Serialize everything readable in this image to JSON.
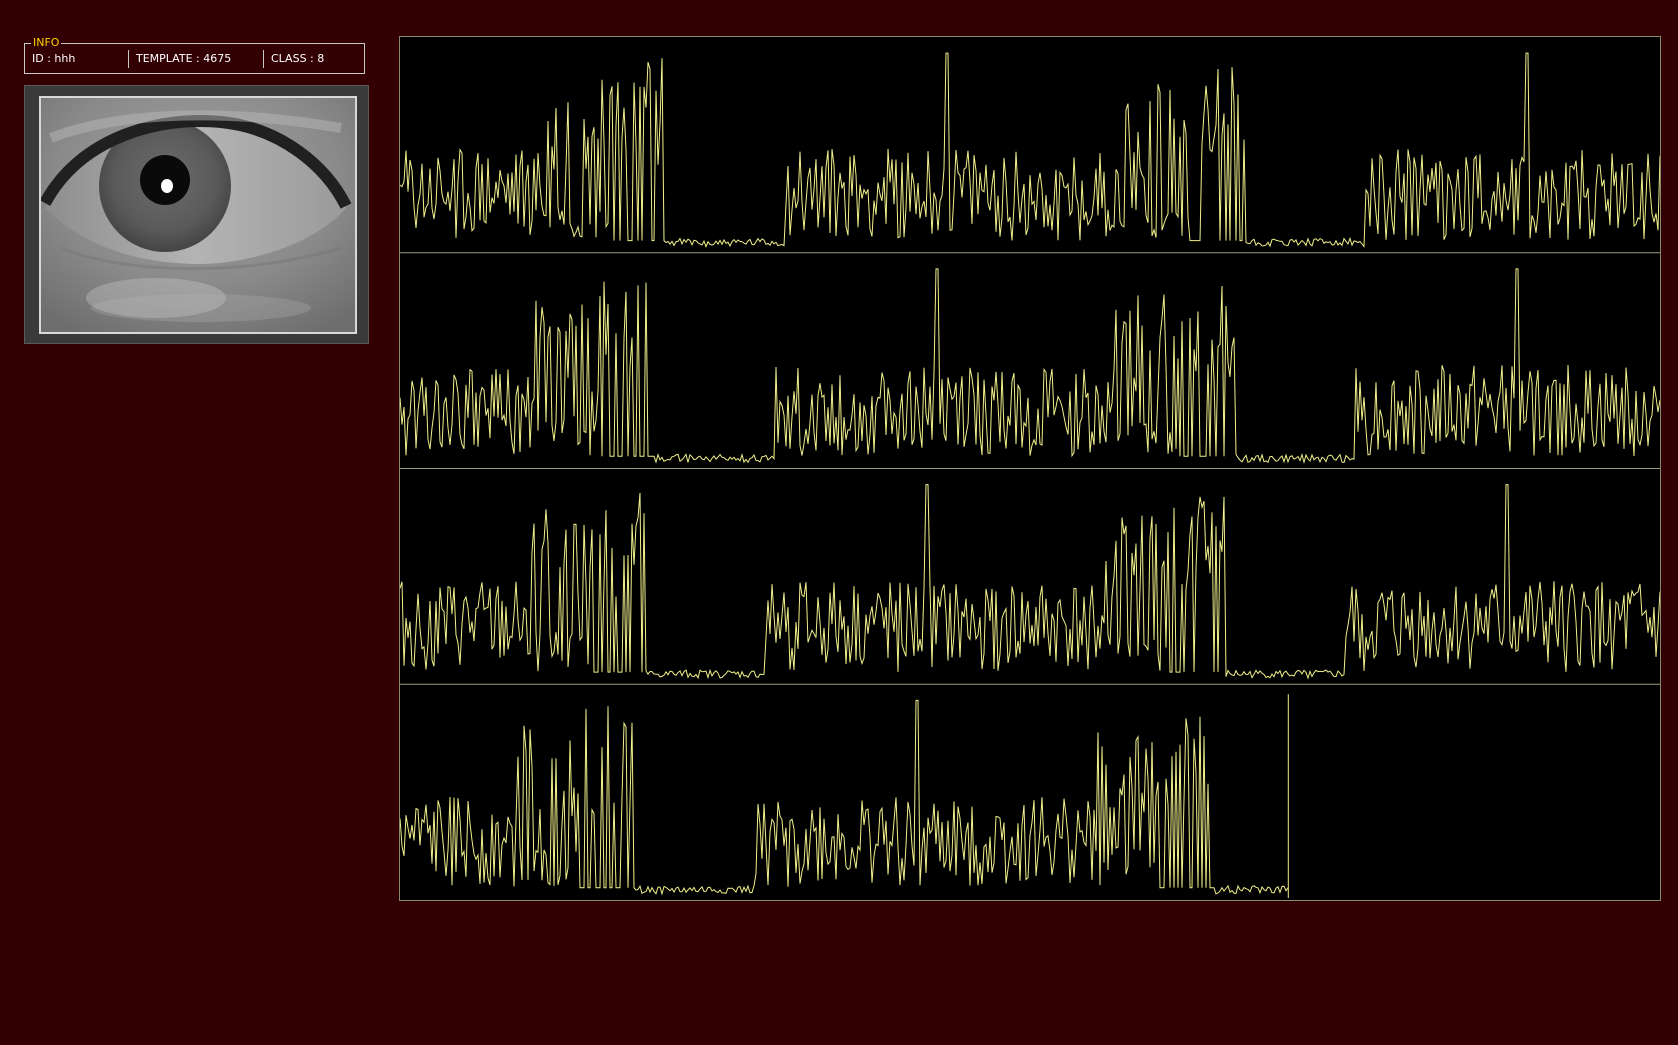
{
  "info": {
    "legend": "INFO",
    "id_text": "ID : hhh",
    "template_text": "TEMPLATE :  4675",
    "class_text": "CLASS :  8"
  },
  "colors": {
    "background": "#320003",
    "accent": "#ffd200",
    "signal": "#f0f08c",
    "panel_border": "#8a8a6a"
  },
  "chart_data": {
    "type": "line",
    "title": "",
    "rows": 4,
    "row_coverage": [
      1,
      1,
      1,
      0.705
    ],
    "series": [
      {
        "name": "",
        "values": []
      }
    ]
  }
}
